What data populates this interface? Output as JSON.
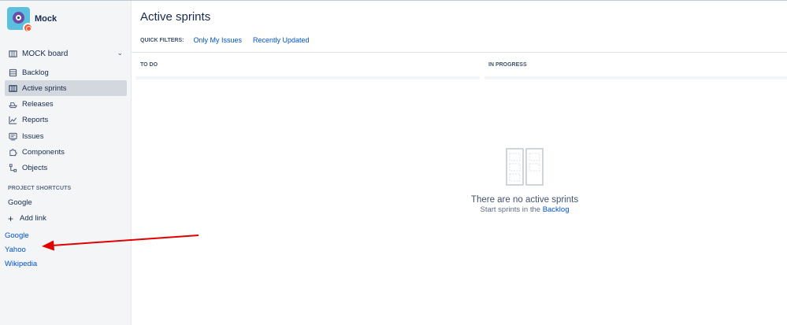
{
  "project": {
    "name": "Mock"
  },
  "board_selector": {
    "label": "MOCK board"
  },
  "nav": {
    "items": [
      {
        "label": "Backlog",
        "icon": "backlog-icon"
      },
      {
        "label": "Active sprints",
        "icon": "board-icon",
        "active": true
      },
      {
        "label": "Releases",
        "icon": "ship-icon"
      },
      {
        "label": "Reports",
        "icon": "chart-icon"
      },
      {
        "label": "Issues",
        "icon": "issues-icon"
      },
      {
        "label": "Components",
        "icon": "puzzle-icon"
      },
      {
        "label": "Objects",
        "icon": "tree-icon"
      }
    ]
  },
  "shortcuts": {
    "title": "PROJECT SHORTCUTS",
    "items": [
      "Google"
    ],
    "add_label": "Add link"
  },
  "external_links": [
    "Google",
    "Yahoo",
    "Wikipedia"
  ],
  "main": {
    "title": "Active sprints",
    "quick_filters": {
      "label": "QUICK FILTERS:",
      "buttons": [
        "Only My Issues",
        "Recently Updated"
      ]
    },
    "columns": [
      "TO DO",
      "IN PROGRESS"
    ],
    "empty_state": {
      "title": "There are no active sprints",
      "subtitle_prefix": "Start sprints in the",
      "link": "Backlog"
    }
  },
  "colors": {
    "sidebar_bg": "#f4f5f7",
    "active_item_bg": "#d3d7de",
    "link": "#0052cc",
    "annotation_arrow": "#e00000"
  }
}
